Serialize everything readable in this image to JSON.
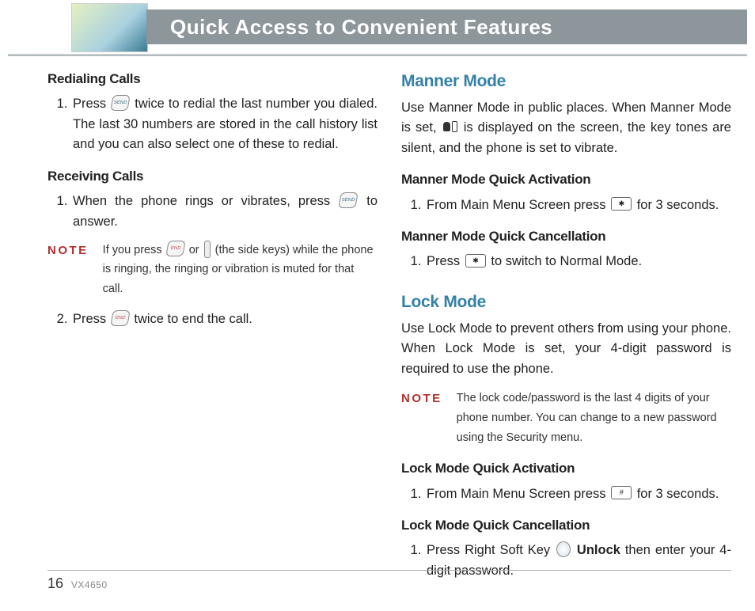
{
  "header": {
    "title": "Quick Access to Convenient Features"
  },
  "left": {
    "sub1": "Redialing Calls",
    "item1a": "Press ",
    "item1b": " twice to redial the last number you dialed. The last 30 numbers are stored in the call history list and you can also select one of these to redial.",
    "sub2": "Receiving Calls",
    "item2a": "When the phone rings or vibrates, press ",
    "item2b": " to answer.",
    "note_label": "NOTE",
    "note1a": "If you press ",
    "note1b": " or ",
    "note1c": " (the side keys) while the phone is ringing, the ringing or vibration is muted for that call.",
    "item3a": "Press ",
    "item3b": " twice to end the call."
  },
  "right": {
    "title1": "Manner Mode",
    "p1a": "Use Manner Mode in public places. When Manner Mode is set, ",
    "p1b": " is displayed on the screen, the key tones are silent, and the phone is set to vibrate.",
    "sub1": "Manner Mode Quick Activation",
    "i1a": "From Main Menu Screen press ",
    "i1b": " for 3 seconds.",
    "sub2": "Manner Mode Quick Cancellation",
    "i2a": "Press ",
    "i2b": " to switch to Normal Mode.",
    "title2": "Lock Mode",
    "p2": "Use Lock Mode to prevent others from using your phone. When Lock Mode is set, your 4-digit password is required to use the phone.",
    "note_label": "NOTE",
    "note2": "The lock code/password is the last 4 digits of your phone number. You can change to a new password using the Security menu.",
    "sub3": "Lock Mode Quick Activation",
    "i3a": "From Main Menu Screen press ",
    "i3b": " for 3 seconds.",
    "sub4": "Lock Mode Quick Cancellation",
    "i4a": "Press Right Soft Key ",
    "i4b": "Unlock",
    "i4c": " then enter your 4-digit password."
  },
  "keys": {
    "send": "SEND",
    "end": "END",
    "star": "✱ ",
    "hash": "# "
  },
  "footer": {
    "page": "16",
    "model": "VX4650"
  }
}
